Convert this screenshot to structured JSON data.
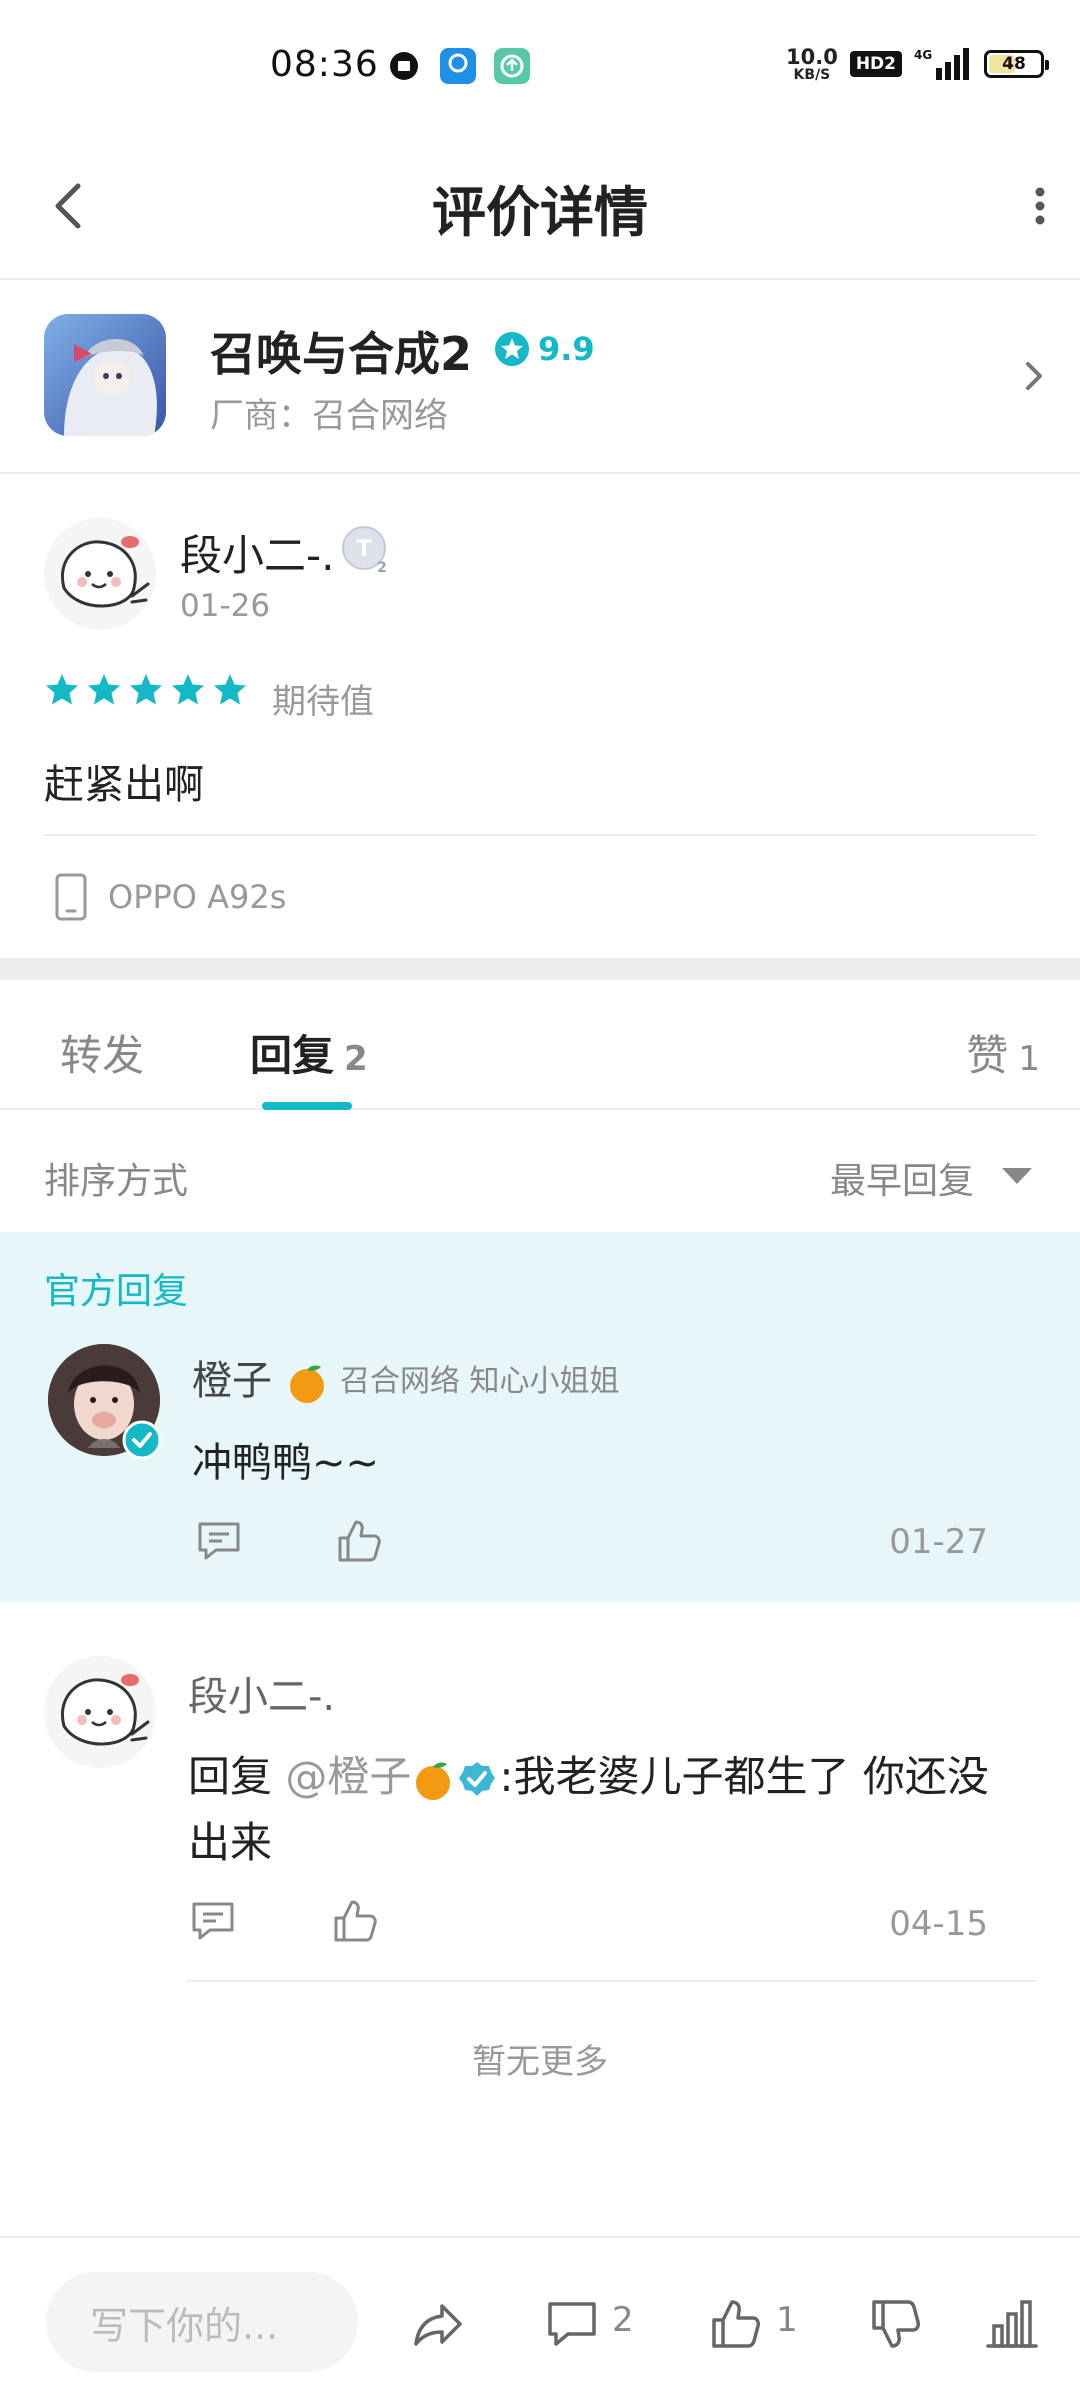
{
  "status_bar": {
    "time": "08:36",
    "net_speed_value": "10.0",
    "net_speed_unit": "KB/S",
    "hd_label": "HD2",
    "network": "4G",
    "battery": "48"
  },
  "header": {
    "title": "评价详情"
  },
  "app": {
    "name": "召唤与合成2",
    "score": "9.9",
    "vendor": "厂商：召合网络"
  },
  "review": {
    "author": "段小二-.",
    "date": "01-26",
    "stars": 5,
    "star_label": "期待值",
    "content": "赶紧出啊",
    "device": "OPPO A92s"
  },
  "tabs": [
    {
      "label": "转发",
      "count": ""
    },
    {
      "label": "回复",
      "count": "2"
    },
    {
      "label": "赞",
      "count": "1"
    }
  ],
  "sort": {
    "label": "排序方式",
    "value": "最早回复"
  },
  "replies": {
    "official_tag": "官方回复",
    "official": {
      "name": "橙子",
      "role": "召合网络 知心小姐姐",
      "content": "冲鸭鸭~~",
      "date": "01-27"
    },
    "user": {
      "name": "段小二-.",
      "prefix": "回复",
      "mention": "@橙子",
      "content": ":我老婆儿子都生了 你还没出来",
      "date": "04-15"
    },
    "no_more": "暂无更多"
  },
  "bottom_bar": {
    "input_placeholder": "写下你的...",
    "comment_count": "2",
    "like_count": "1"
  },
  "colors": {
    "accent": "#14b9c8",
    "official_bg": "#e6f6f9",
    "muted_text": "#999999"
  }
}
